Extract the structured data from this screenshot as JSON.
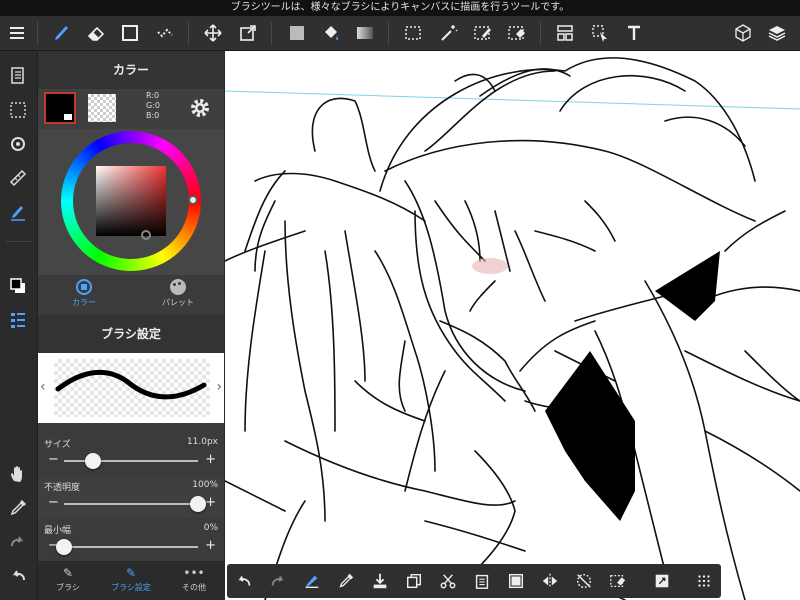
{
  "status_bar": {
    "message": "ブラシツールは、様々なブラシによりキャンバスに描画を行うツールです。"
  },
  "toolbar": {
    "icons": [
      "menu-icon",
      "brush-icon",
      "eraser-icon",
      "rectangle-icon",
      "dot-icon",
      "move-icon",
      "transform-icon",
      "fill-rect-icon",
      "bucket-icon",
      "gradient-icon",
      "select-icon",
      "magic-wand-icon",
      "select-pen-icon",
      "select-eraser-icon",
      "frame-icon",
      "operation-icon",
      "text-icon",
      "3d-icon",
      "layers-icon"
    ]
  },
  "color_panel": {
    "title": "カラー",
    "rgb_readout": {
      "r": "R:0",
      "g": "G:0",
      "b": "B:0"
    },
    "tabs": [
      {
        "label": "カラー"
      },
      {
        "label": "パレット"
      }
    ],
    "colors": {
      "fg": "#000000",
      "accent": "#4a90e2"
    }
  },
  "brush_panel": {
    "title": "ブラシ設定",
    "sliders": [
      {
        "label": "サイズ",
        "value": "11.0px",
        "level": 0.22
      },
      {
        "label": "不透明度",
        "value": "100%",
        "level": 1.0
      },
      {
        "label": "最小幅",
        "value": "0%",
        "level": 0.0
      }
    ],
    "tabs": [
      {
        "label": "ブラシ"
      },
      {
        "label": "ブラシ設定"
      },
      {
        "label": "その他"
      }
    ]
  }
}
